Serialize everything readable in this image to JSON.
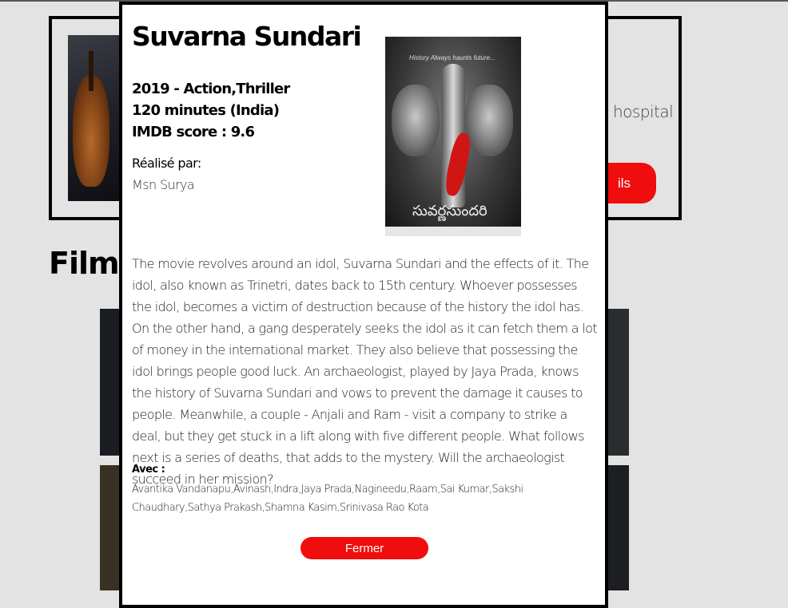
{
  "background": {
    "hero": {
      "text_fragment": "hospital",
      "button_fragment": "ils"
    },
    "section_title_fragment": "Films"
  },
  "modal": {
    "title": "Suvarna Sundari",
    "year_genre": "2019 - Action,Thriller",
    "duration": "120 minutes (India)",
    "imdb": "IMDB score : 9.6",
    "director_label": "Réalisé par:",
    "director": "Msn Surya",
    "poster_tagline": "History  Always  haunts  future...",
    "poster_telugu_title": "సువర్ణసుందరి",
    "plot": "The movie revolves around an idol, Suvarna Sundari and the effects of it. The idol, also known as Trinetri, dates back to 15th century. Whoever possesses the idol, becomes a victim of destruction because of the history the idol has. On the other hand, a gang desperately seeks the idol as it can fetch them a lot of money in the international market. They also believe that possessing the idol brings people good luck. An archaeologist, played by Jaya Prada, knows the history of Suvarna Sundari and vows to prevent the damage it causes to people. Meanwhile, a couple - Anjali and Ram - visit a company to strike a deal, but they get stuck in a lift along with five different people. What follows next is a series of deaths, that adds to the mystery. Will the archaeologist succeed in her mission?",
    "cast_label": "Avec :",
    "cast": "Avantika Vandanapu,Avinash,Indra,Jaya Prada,Nagineedu,Raam,Sai Kumar,Sakshi Chaudhary,Sathya Prakash,Shamna Kasim,Srinivasa Rao Kota",
    "close_label": "Fermer"
  },
  "colors": {
    "accent_red": "#f00d0d",
    "page_bg": "#e3e3e3"
  }
}
